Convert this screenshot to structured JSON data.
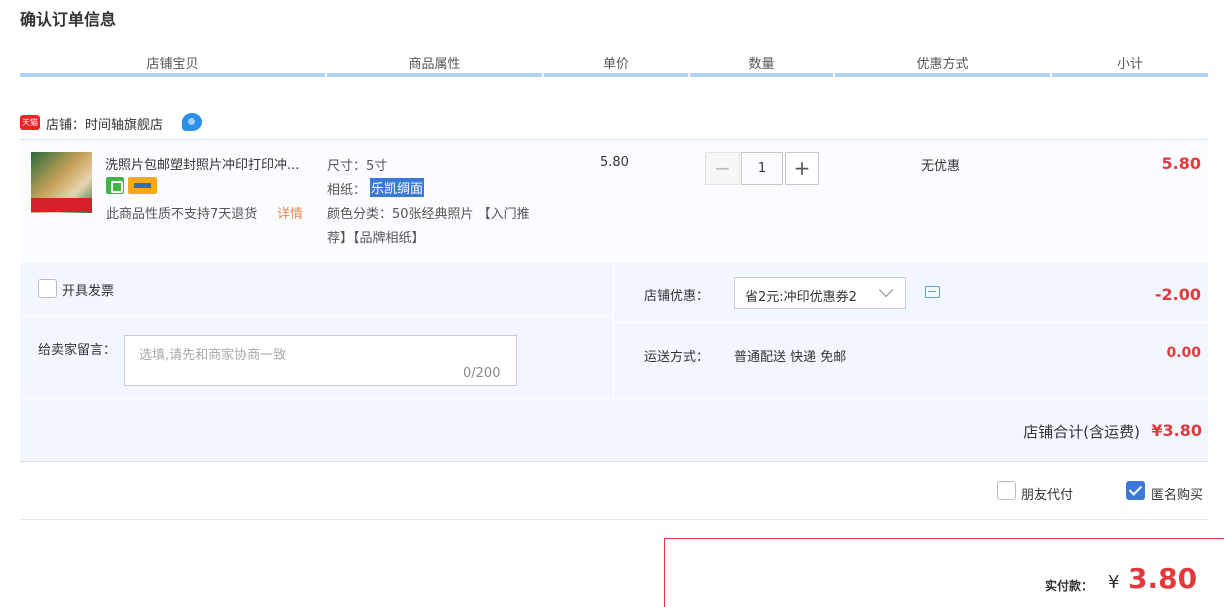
{
  "page": {
    "title": "确认订单信息"
  },
  "columns": [
    "店铺宝贝",
    "商品属性",
    "单价",
    "数量",
    "优惠方式",
    "小计"
  ],
  "shop": {
    "badge": "天猫",
    "name": "店铺：时间轴旗舰店"
  },
  "item": {
    "title": "洗照片包邮塑封照片冲印打印冲...",
    "return_note": "此商品性质不支持7天退货",
    "detail_link": "详情",
    "attr_size": "尺寸：5寸",
    "attr_paper_label": "相纸：",
    "attr_paper_value": "乐凯绸面",
    "attr_color": "颜色分类：50张经典照片 【入门推荐】【品牌相纸】",
    "unit_price": "5.80",
    "quantity": "1",
    "qty_minus": "−",
    "qty_plus": "+",
    "discount_way": "无优惠",
    "subtotal": "5.80"
  },
  "options": {
    "invoice_label": "开具发票",
    "memo_label": "给卖家留言：",
    "memo_placeholder": "选填,请先和商家协商一致",
    "memo_count": "0/200",
    "shop_discount_label": "店铺优惠：",
    "coupon_selected": "省2元:冲印优惠券2",
    "shop_discount_value": "-2.00",
    "shipping_label": "运送方式：",
    "shipping_value": "普通配送 快递 免邮",
    "shipping_fee": "0.00",
    "shop_total_label": "店铺合计(含运费)",
    "shop_total_value": "¥3.80"
  },
  "payment": {
    "friend_pay_label": "朋友代付",
    "anonymous_label": "匿名购买",
    "anonymous_checked": true,
    "pay_label": "实付款：",
    "currency": "¥",
    "pay_value": "3.80"
  },
  "colors": {
    "accent_red": "#e4393c",
    "header_bar": "#b2d1f0",
    "option_bg": "#f2f7ff",
    "check_blue": "#3a7ad6"
  }
}
